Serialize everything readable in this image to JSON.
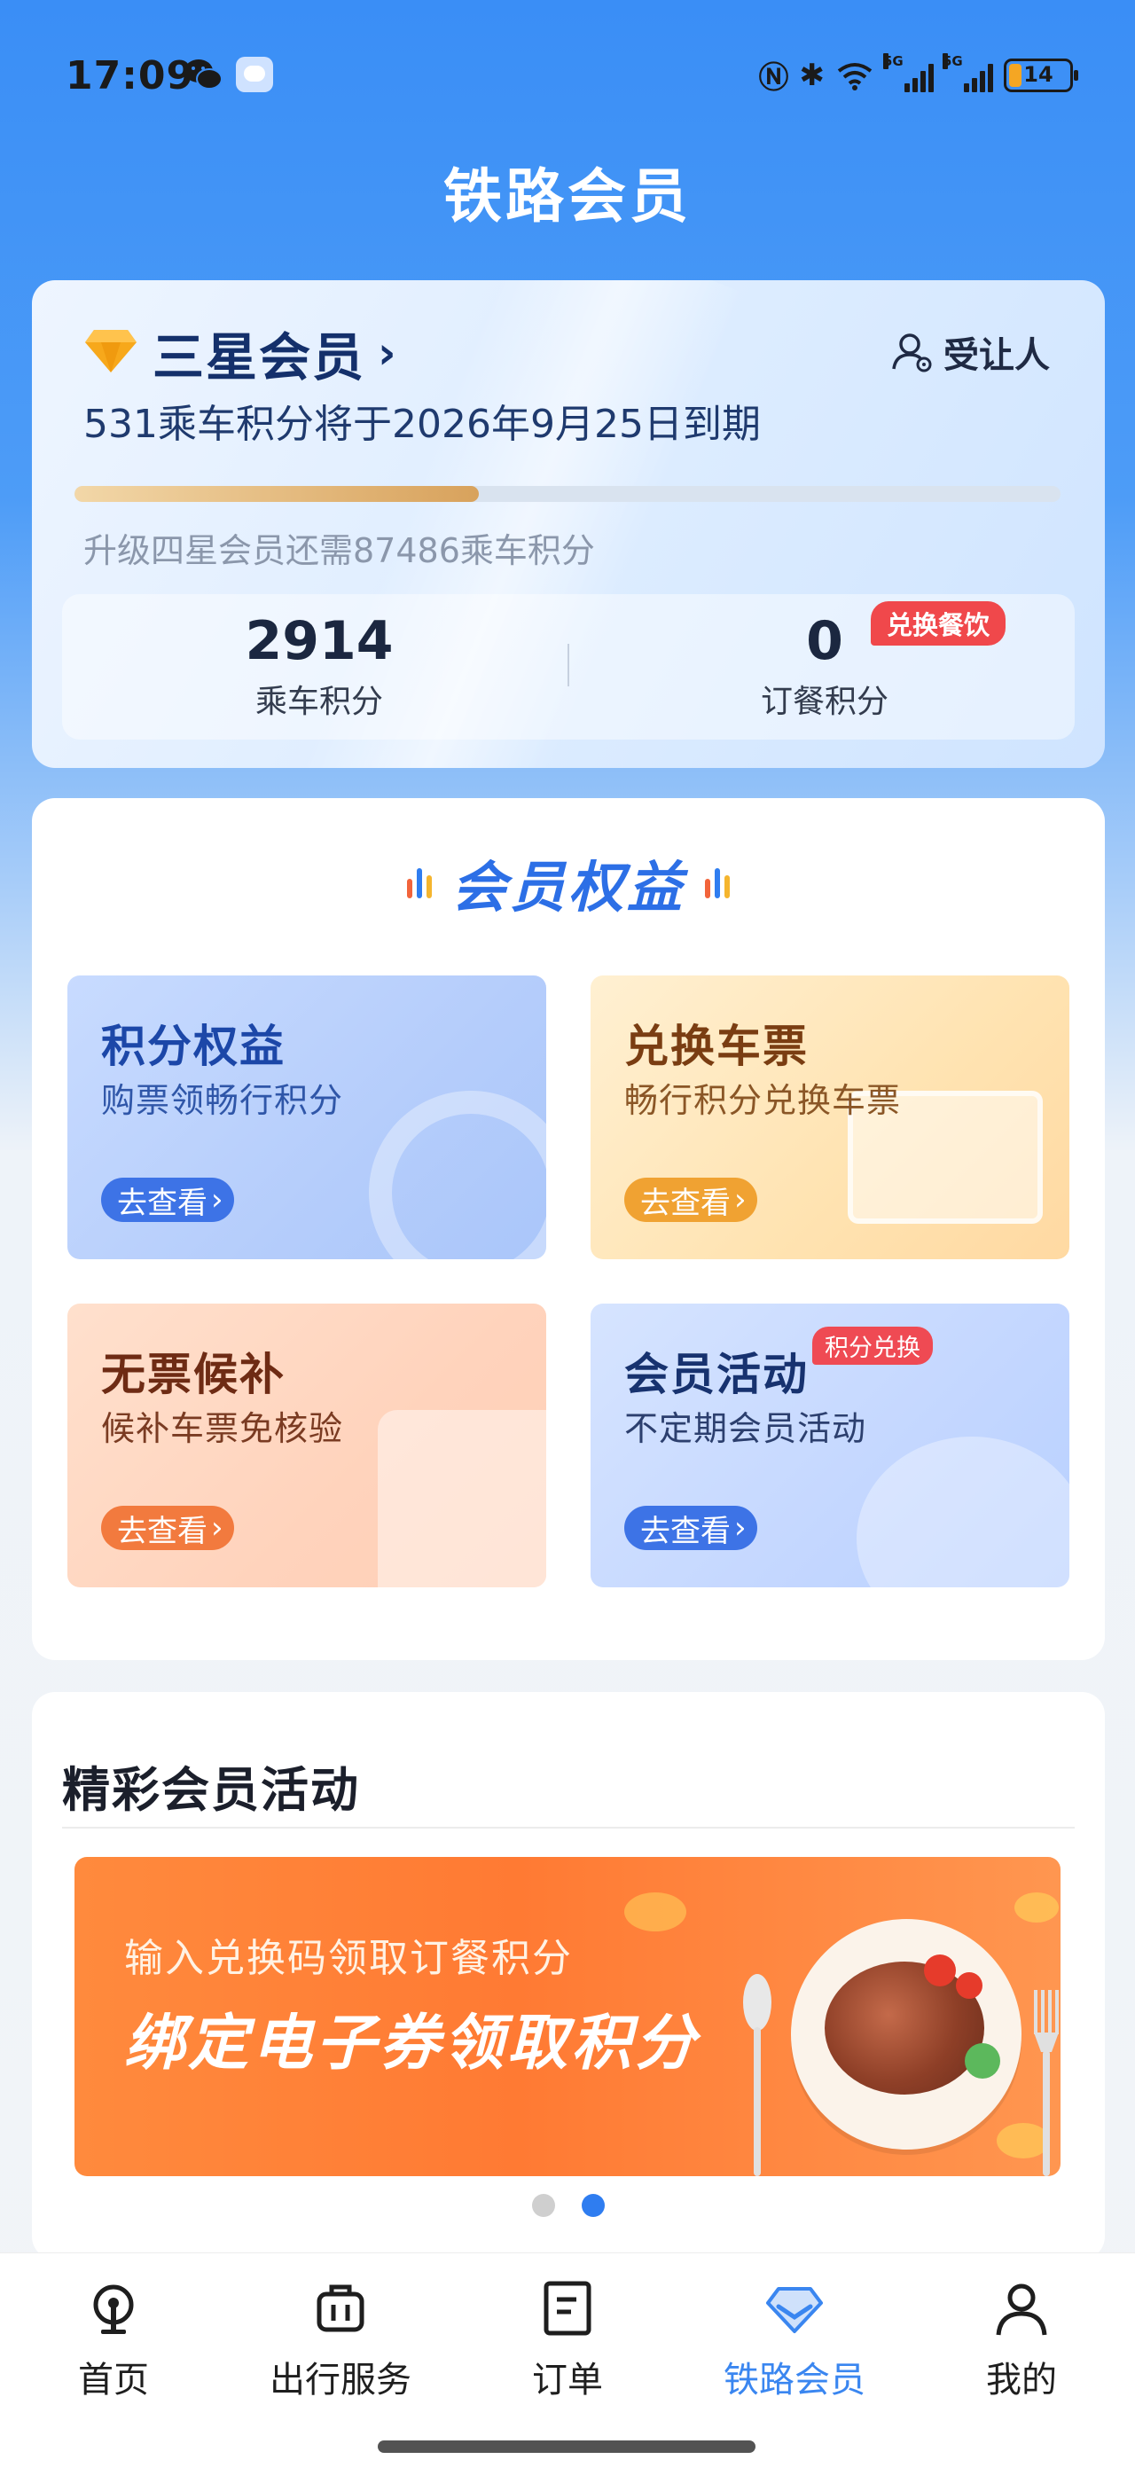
{
  "status_bar": {
    "time": "17:09",
    "battery_level": "14",
    "network_tags": [
      "5G",
      "5G"
    ]
  },
  "header": {
    "title": "铁路会员"
  },
  "member_card": {
    "level": "三星会员",
    "beneficiary": "受让人",
    "expiry_notice": "531乘车积分将于2026年9月25日到期",
    "progress_fraction": 0.41,
    "upgrade_notice": "升级四星会员还需87486乘车积分",
    "ride_points": {
      "value": "2914",
      "label": "乘车积分"
    },
    "meal_points": {
      "value": "0",
      "label": "订餐积分",
      "tag": "兑换餐饮"
    }
  },
  "benefits": {
    "title": "会员权益",
    "tiles": [
      {
        "title": "积分权益",
        "subtitle": "购票领畅行积分",
        "button": "去查看"
      },
      {
        "title": "兑换车票",
        "subtitle": "畅行积分兑换车票",
        "button": "去查看"
      },
      {
        "title": "无票候补",
        "subtitle": "候补车票免核验",
        "button": "去查看"
      },
      {
        "title": "会员活动",
        "subtitle": "不定期会员活动",
        "button": "去查看",
        "badge": "积分兑换"
      }
    ]
  },
  "activities": {
    "title": "精彩会员活动",
    "banner": {
      "subtitle": "输入兑换码领取订餐积分",
      "headline": "绑定电子券领取积分"
    },
    "carousel": {
      "count": 2,
      "active_index": 1
    }
  },
  "bottom_nav": {
    "items": [
      {
        "label": "首页",
        "icon": "home-icon"
      },
      {
        "label": "出行服务",
        "icon": "luggage-icon"
      },
      {
        "label": "订单",
        "icon": "order-icon"
      },
      {
        "label": "铁路会员",
        "icon": "diamond-icon",
        "active": true
      },
      {
        "label": "我的",
        "icon": "profile-icon"
      }
    ]
  },
  "colors": {
    "primary": "#3a8ef6",
    "accent_red": "#f0484b",
    "active_nav": "#3a86f0"
  }
}
